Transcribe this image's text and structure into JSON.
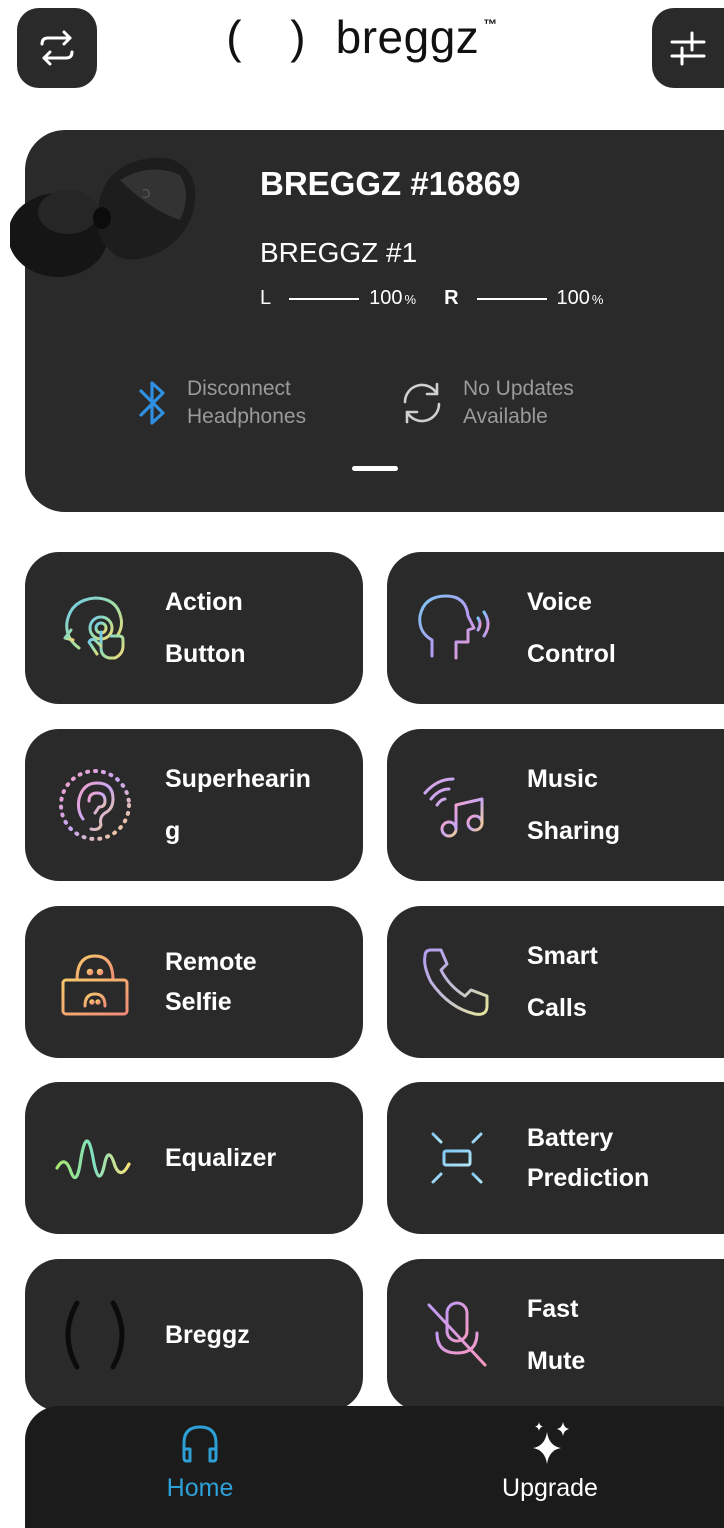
{
  "header": {
    "brand": "breggz",
    "brand_mark": "( )",
    "trademark": "™",
    "swap_icon": "swap-arrows-icon",
    "settings_icon": "sliders-icon"
  },
  "device": {
    "name": "BREGGZ #16869",
    "subname": "BREGGZ #1",
    "battery": {
      "left_label": "L",
      "left_value": "100",
      "right_label": "R",
      "right_value": "100",
      "unit": "%"
    },
    "disconnect_label": "Disconnect\nHeadphones",
    "update_label": "No Updates\nAvailable"
  },
  "tiles": [
    {
      "label": "Action\nButton",
      "icon": "touch-head-icon"
    },
    {
      "label": "Voice\nControl",
      "icon": "voice-head-icon"
    },
    {
      "label": "Superhearin\ng",
      "icon": "ear-icon"
    },
    {
      "label": "Music\nSharing",
      "icon": "music-share-icon"
    },
    {
      "label": "Remote\nSelfie",
      "icon": "selfie-icon"
    },
    {
      "label": "Smart\nCalls",
      "icon": "phone-icon"
    },
    {
      "label": "Equalizer",
      "icon": "waveform-icon"
    },
    {
      "label": "Battery\nPrediction",
      "icon": "battery-glow-icon"
    },
    {
      "label": "Breggz",
      "icon": "breggz-logo-icon"
    },
    {
      "label": "Fast\nMute",
      "icon": "mic-off-icon"
    }
  ],
  "nav": {
    "home_label": "Home",
    "upgrade_label": "Upgrade"
  },
  "colors": {
    "card": "#2a2a2a",
    "nav_bg": "#1b1b1b",
    "accent": "#2ea0d8",
    "muted_text": "#9a9a9a"
  }
}
